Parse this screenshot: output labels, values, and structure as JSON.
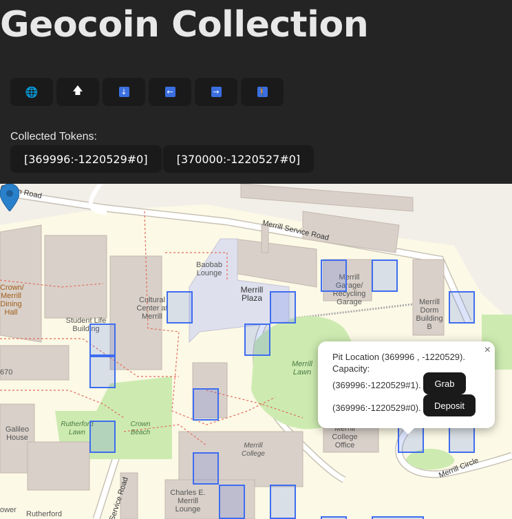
{
  "app": {
    "title": "Geocoin Collection"
  },
  "controls": [
    {
      "name": "globe-button",
      "icon": "🌐"
    },
    {
      "name": "north-button",
      "icon": "🡅"
    },
    {
      "name": "south-button",
      "icon": "↓"
    },
    {
      "name": "west-button",
      "icon": "←"
    },
    {
      "name": "east-button",
      "icon": "→"
    },
    {
      "name": "player-button",
      "icon": "🚶"
    }
  ],
  "collected": {
    "label": "Collected Tokens:",
    "tokens": [
      "[369996:-1220529#0]",
      "[370000:-1220527#0]"
    ]
  },
  "popup": {
    "close": "×",
    "pit_location": "Pit Location (369996 , -1220529).",
    "capacity": "Capacity:",
    "items": [
      {
        "token": "(369996:-1220529#1).",
        "action": "Grab"
      },
      {
        "token": "(369996:-1220529#0).",
        "action": "Deposit"
      }
    ]
  },
  "map_labels": {
    "crown_road": "Crown Road",
    "merrill_service_road": "Merrill Service Road",
    "baobab": "Baobab Lounge",
    "merrill_plaza": "Merrill Plaza",
    "cultural_center": "Cultural Center at Merrill",
    "student_life": "Student Life Building",
    "crown_dining": "Crown/ Merrill Dining Hall",
    "garage": "Merrill Garage/ Recycling Garage",
    "dorm_b": "Merrill Dorm Building B",
    "merrill_lawn": "Merrill Lawn",
    "rutherford_lawn": "Rutherford Lawn",
    "crown_beach": "Crown Beach",
    "galileo": "Galileo House",
    "merrill_college": "Merrill College",
    "college_office": "Merrill College Office",
    "charles_lounge": "Charles E. Merrill Lounge",
    "merrill_circle": "Merrill Circle",
    "rutherford": "Rutherford",
    "service_road": "Service Road",
    "tower": "ower",
    "num_670": "670"
  },
  "colors": {
    "background": "#242424",
    "cell_border": "#3d6cf0",
    "marker": "#2a81cb"
  }
}
